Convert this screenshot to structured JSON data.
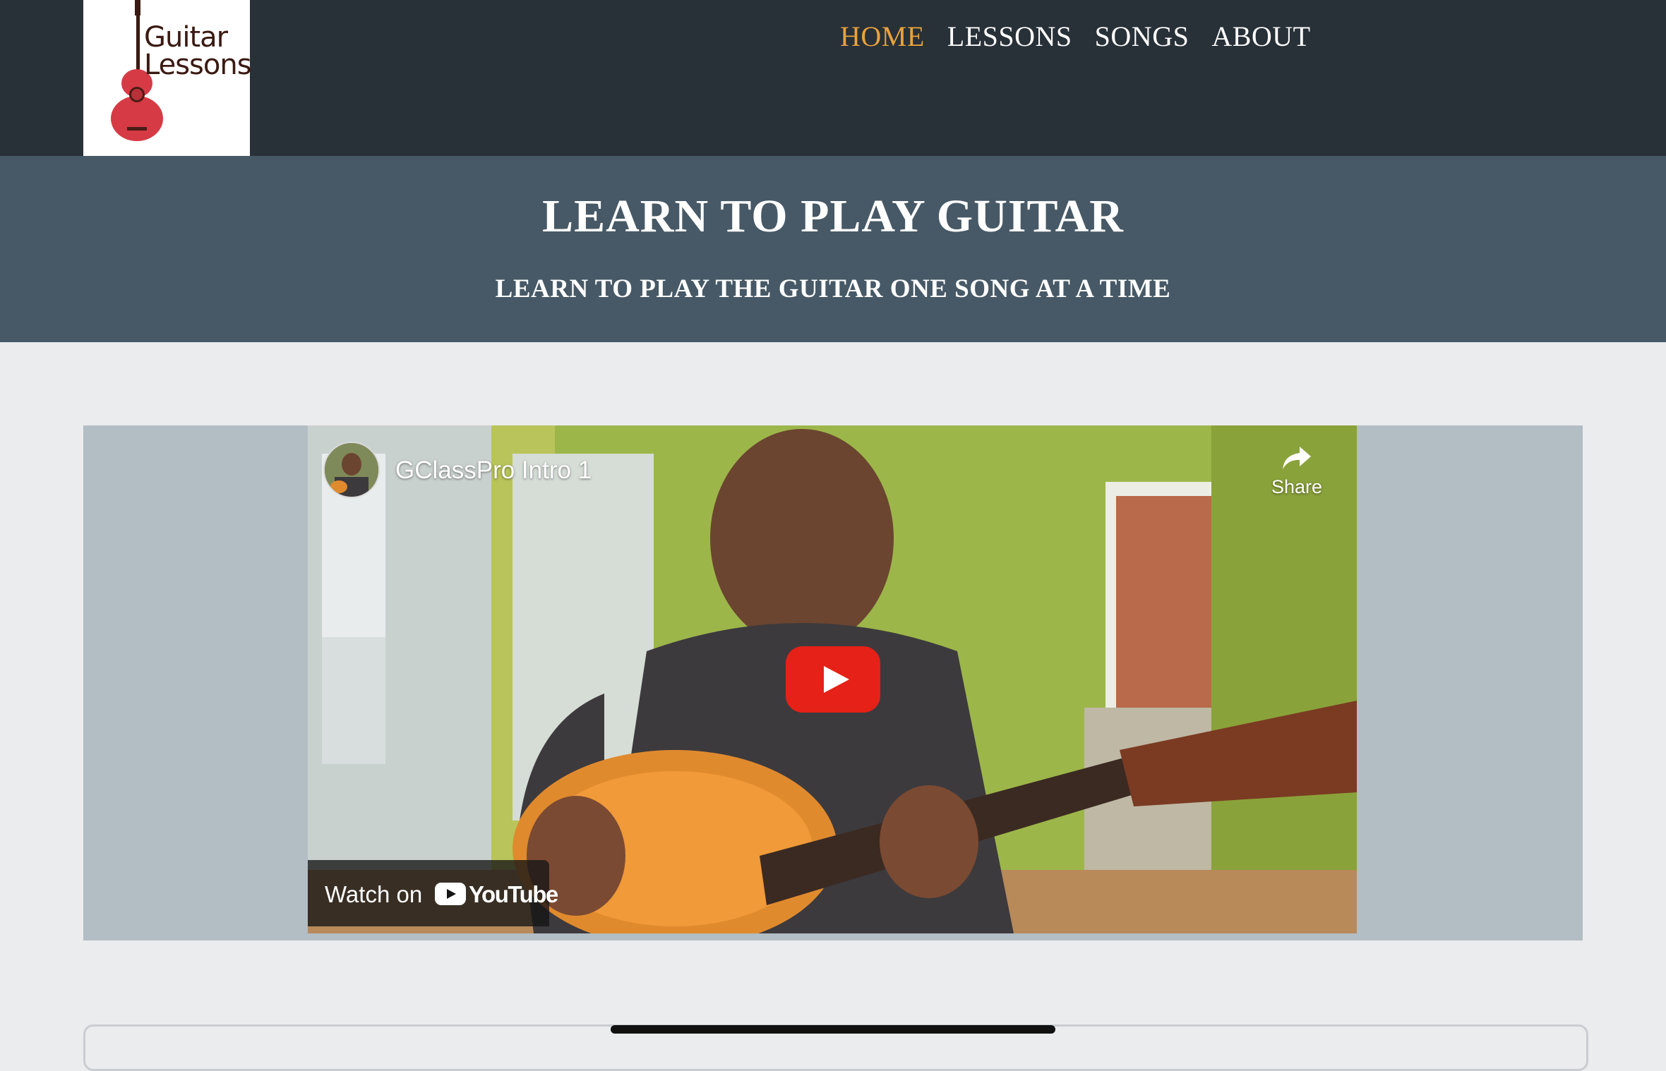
{
  "header": {
    "logo_line1": "Guitar",
    "logo_line2": "Lessons",
    "nav": [
      "HOME",
      "LESSONS",
      "SONGS",
      "ABOUT"
    ],
    "active_nav": "HOME",
    "accent_color": "#e8a33d",
    "background": "#283038"
  },
  "hero": {
    "title": "LEARN TO PLAY GUITAR",
    "subtitle": "LEARN TO PLAY THE GUITAR ONE SONG AT A TIME",
    "background": "#475966"
  },
  "video": {
    "title": "GClassPro Intro 1",
    "share_label": "Share",
    "watch_label": "Watch on",
    "platform": "YouTube",
    "play_color": "#e62117"
  }
}
